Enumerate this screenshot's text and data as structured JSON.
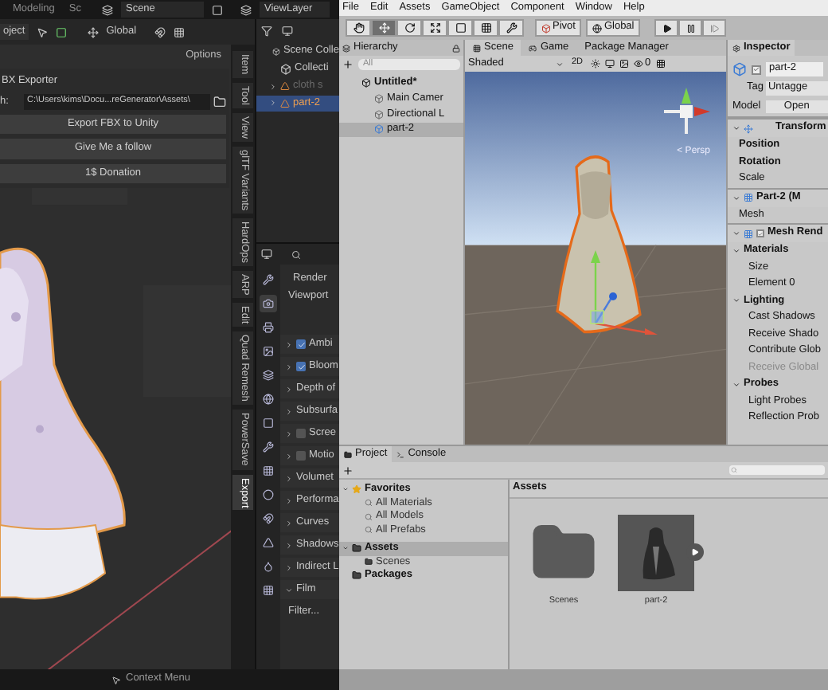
{
  "blender": {
    "header": {
      "workspaces": [
        {
          "label": "Modeling",
          "selected": false
        },
        {
          "label": "Sc",
          "selected": false
        }
      ],
      "scene": "Scene",
      "view_layer": "ViewLayer"
    },
    "viewport_header": {
      "mode": "oject",
      "orientation": "Global",
      "options": "Options"
    },
    "fbx_panel": {
      "title": "BX Exporter",
      "path_label": "h:",
      "path": "C:\\Users\\kims\\Docu...reGenerator\\Assets\\",
      "buttons": [
        "Export FBX to Unity",
        "Give Me a follow",
        "1$ Donation"
      ]
    },
    "sidebar_tabs": [
      {
        "label": "Item",
        "selected": false
      },
      {
        "label": "Tool",
        "selected": false
      },
      {
        "label": "View",
        "selected": false
      },
      {
        "label": "glTF Variants",
        "selected": false
      },
      {
        "label": "HardOps",
        "selected": false
      },
      {
        "label": "ARP",
        "selected": false
      },
      {
        "label": "Edit",
        "selected": false
      },
      {
        "label": "Quad Remesh",
        "selected": false
      },
      {
        "label": "PowerSave",
        "selected": false
      },
      {
        "label": "Export",
        "selected": true
      }
    ],
    "outliner": {
      "items": [
        {
          "label": "Scene Colle",
          "kind": "scene",
          "disabled": false,
          "selected": false,
          "children": [
            {
              "label": "Collecti",
              "kind": "collection",
              "disabled": false,
              "selected": false
            },
            {
              "label": "cloth s",
              "kind": "mesh",
              "disabled": true,
              "selected": false
            },
            {
              "label": "part-2",
              "kind": "mesh",
              "disabled": false,
              "selected": true
            }
          ]
        }
      ]
    },
    "properties": {
      "tabs": [
        {
          "kind": "tool",
          "selected": false
        },
        {
          "kind": "render",
          "selected": true
        },
        {
          "kind": "output",
          "selected": false
        },
        {
          "kind": "view",
          "selected": false
        },
        {
          "kind": "scene",
          "selected": false
        },
        {
          "kind": "world",
          "selected": false
        },
        {
          "kind": "object",
          "selected": false
        },
        {
          "kind": "modifier",
          "selected": false
        },
        {
          "kind": "particles",
          "selected": false
        },
        {
          "kind": "physics",
          "selected": false
        },
        {
          "kind": "constraint",
          "selected": false
        },
        {
          "kind": "data",
          "selected": false
        },
        {
          "kind": "material",
          "selected": false
        },
        {
          "kind": "texture",
          "selected": false
        }
      ],
      "render_label": "Render",
      "viewport_label": "Viewport",
      "panels": [
        {
          "label": "Ambi",
          "kind": "check",
          "checked": true,
          "expanded": false
        },
        {
          "label": "Bloom",
          "kind": "check",
          "checked": true,
          "expanded": false
        },
        {
          "label": "Depth of",
          "kind": "plain",
          "expanded": false
        },
        {
          "label": "Subsurfa",
          "kind": "plain",
          "expanded": false
        },
        {
          "label": "Scree",
          "kind": "check",
          "checked": false,
          "expanded": false
        },
        {
          "label": "Motio",
          "kind": "check",
          "checked": false,
          "expanded": false
        },
        {
          "label": "Volumet",
          "kind": "plain",
          "expanded": false
        },
        {
          "label": "Performa",
          "kind": "plain",
          "expanded": false
        },
        {
          "label": "Curves",
          "kind": "plain",
          "expanded": false
        },
        {
          "label": "Shadows",
          "kind": "plain",
          "expanded": false
        },
        {
          "label": "Indirect L",
          "kind": "plain",
          "expanded": false
        },
        {
          "label": "Film",
          "kind": "plain",
          "expanded": true
        }
      ],
      "filter_label": "Filter..."
    },
    "status_bar": {
      "hint": "Context Menu"
    }
  },
  "unity": {
    "menu": [
      "File",
      "Edit",
      "Assets",
      "GameObject",
      "Component",
      "Window",
      "Help"
    ],
    "toolbar": {
      "tools": [
        {
          "kind": "hand",
          "selected": false
        },
        {
          "kind": "move",
          "selected": true
        },
        {
          "kind": "rotate",
          "selected": false
        },
        {
          "kind": "scale",
          "selected": false
        },
        {
          "kind": "rect",
          "selected": false
        },
        {
          "kind": "transform",
          "selected": false
        },
        {
          "kind": "custom",
          "selected": false
        }
      ],
      "pivot": "Pivot",
      "space": "Global"
    },
    "hierarchy": {
      "title": "Hierarchy",
      "search_placeholder": "All",
      "scene": "Untitled*",
      "items": [
        {
          "label": "Main Camer",
          "kind": "object",
          "selected": false
        },
        {
          "label": "Directional L",
          "kind": "object",
          "selected": false
        },
        {
          "label": "part-2",
          "kind": "model",
          "selected": true
        }
      ]
    },
    "scene_view": {
      "tabs": [
        {
          "label": "Scene",
          "kind": "scene",
          "selected": true
        },
        {
          "label": "Game",
          "kind": "game",
          "selected": false
        },
        {
          "label": "Package Manager",
          "kind": "plain",
          "selected": false
        }
      ],
      "shading": "Shaded",
      "mode_2d": "2D",
      "gizmo_count": "0",
      "projection": "< Persp"
    },
    "inspector": {
      "title": "Inspector",
      "object_name": "part-2",
      "active": true,
      "tag_label": "Tag",
      "tag": "Untagge",
      "model_label": "Model",
      "model_button": "Open",
      "rows": [
        {
          "kind": "transform",
          "label": "Transform",
          "expanded": true
        },
        {
          "kind": "field",
          "label": "Position",
          "modified": true,
          "disabled": false
        },
        {
          "kind": "field",
          "label": "Rotation",
          "modified": true,
          "disabled": false
        },
        {
          "kind": "field",
          "label": "Scale",
          "modified": false,
          "disabled": false
        },
        {
          "kind": "mesh_filter",
          "label": "Part-2 (M",
          "expanded": true
        },
        {
          "kind": "field",
          "label": "Mesh",
          "modified": false,
          "disabled": false
        },
        {
          "kind": "renderer",
          "label": "Mesh Rend",
          "expanded": true,
          "enabled": true
        },
        {
          "kind": "section",
          "label": "Materials",
          "expanded": true
        },
        {
          "kind": "subfield",
          "label": "Size",
          "disabled": false
        },
        {
          "kind": "subfield",
          "label": "Element 0",
          "disabled": false
        },
        {
          "kind": "section",
          "label": "Lighting",
          "expanded": true
        },
        {
          "kind": "subfield",
          "label": "Cast Shadows",
          "disabled": false
        },
        {
          "kind": "subfield",
          "label": "Receive Shado",
          "disabled": false
        },
        {
          "kind": "subfield",
          "label": "Contribute Glob",
          "disabled": false
        },
        {
          "kind": "subfield",
          "label": "Receive Global",
          "disabled": true
        },
        {
          "kind": "section",
          "label": "Probes",
          "expanded": true
        },
        {
          "kind": "subfield",
          "label": "Light Probes",
          "disabled": false
        },
        {
          "kind": "subfield",
          "label": "Reflection Prob",
          "disabled": false
        }
      ]
    },
    "project": {
      "tabs": [
        {
          "label": "Project",
          "kind": "project",
          "selected": true
        },
        {
          "label": "Console",
          "kind": "console",
          "selected": false
        }
      ],
      "tree": [
        {
          "label": "Favorites",
          "kind": "favorites",
          "expanded": true,
          "selected": false,
          "children": [
            {
              "label": "All Materials",
              "kind": "search",
              "selected": false
            },
            {
              "label": "All Models",
              "kind": "search",
              "selected": false
            },
            {
              "label": "All Prefabs",
              "kind": "search",
              "selected": false
            }
          ]
        },
        {
          "label": "Assets",
          "kind": "folder",
          "expanded": true,
          "selected": true,
          "children": [
            {
              "label": "Scenes",
              "kind": "folder",
              "selected": false
            }
          ]
        },
        {
          "label": "Packages",
          "kind": "folder",
          "expanded": false,
          "selected": false
        }
      ],
      "breadcrumb": "Assets",
      "assets": [
        {
          "label": "Scenes",
          "kind": "folder"
        },
        {
          "label": "part-2",
          "kind": "model"
        }
      ]
    }
  }
}
